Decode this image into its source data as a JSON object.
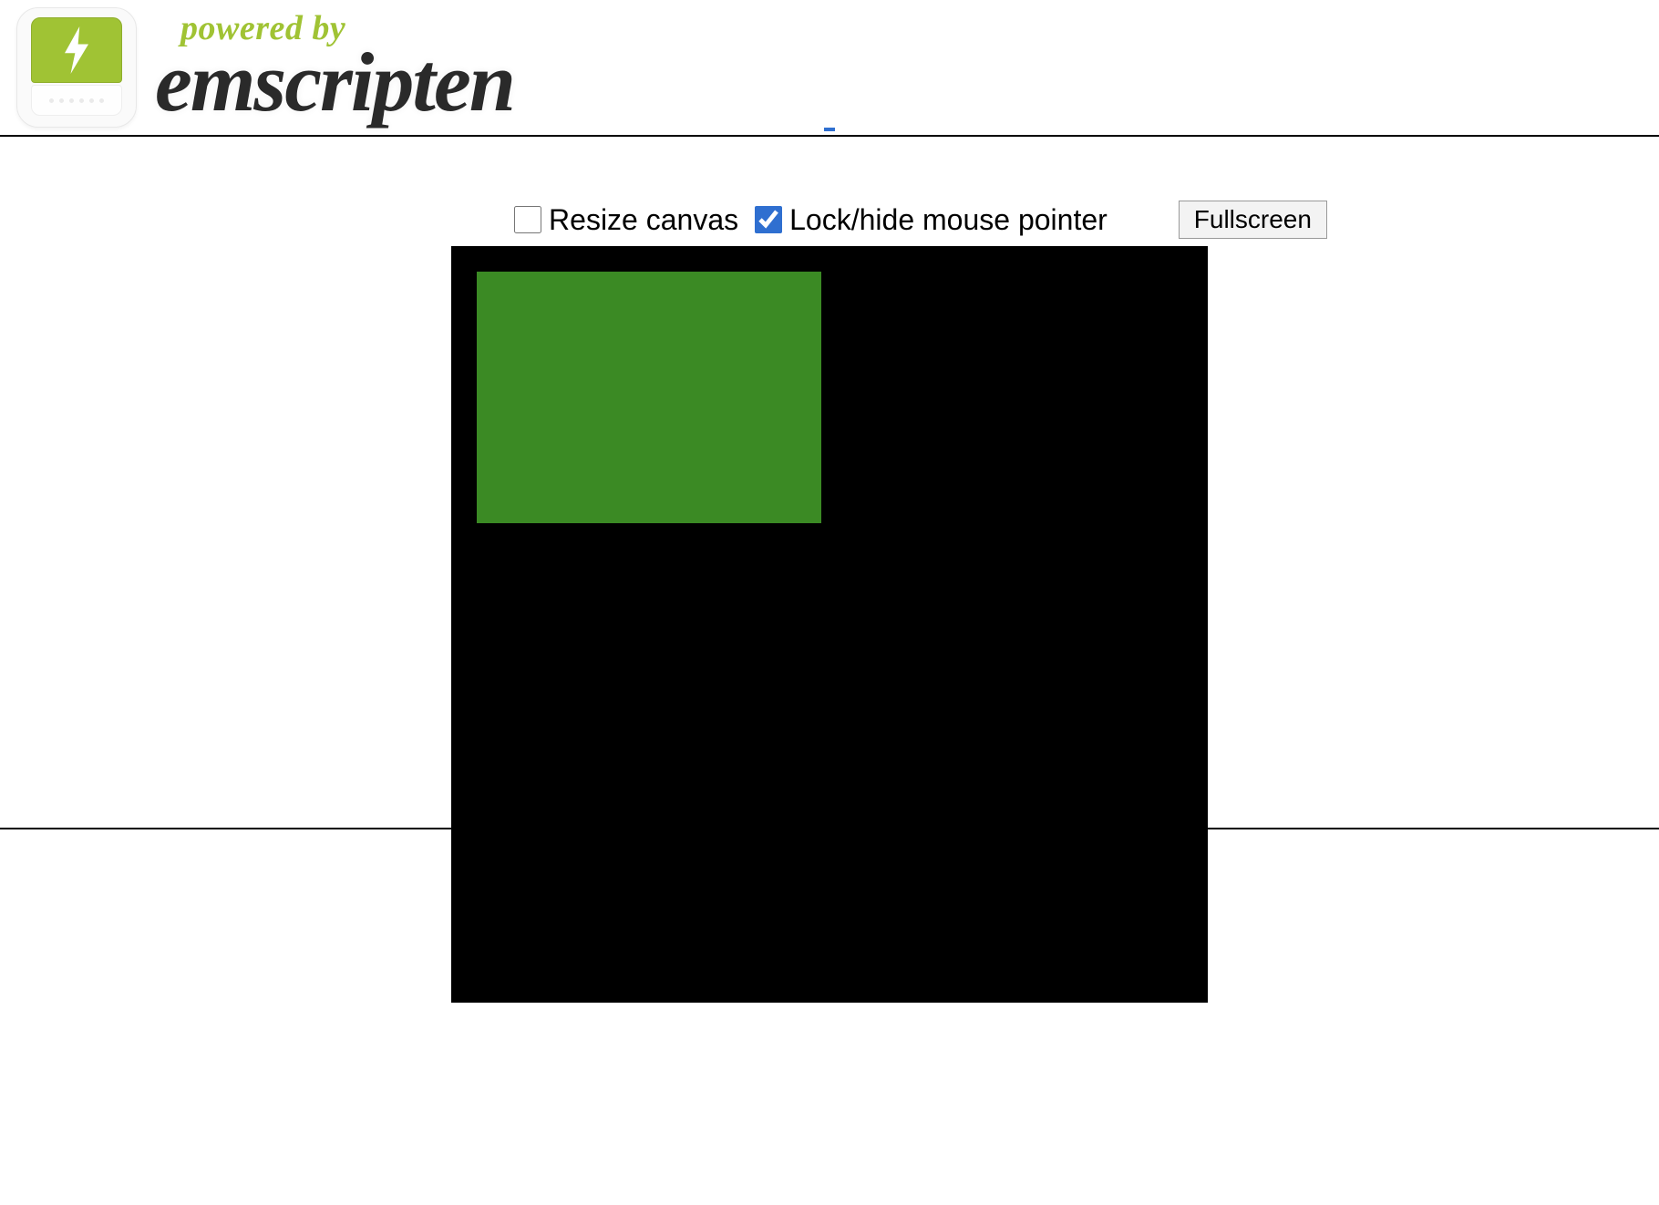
{
  "header": {
    "powered_by": "powered by",
    "brand": "emscripten"
  },
  "controls": {
    "resize_label": "Resize canvas",
    "resize_checked": false,
    "lock_label": "Lock/hide mouse pointer",
    "lock_checked": true,
    "fullscreen_label": "Fullscreen"
  },
  "canvas": {
    "bg_color": "#000000",
    "rect_color": "#3b8a24"
  }
}
